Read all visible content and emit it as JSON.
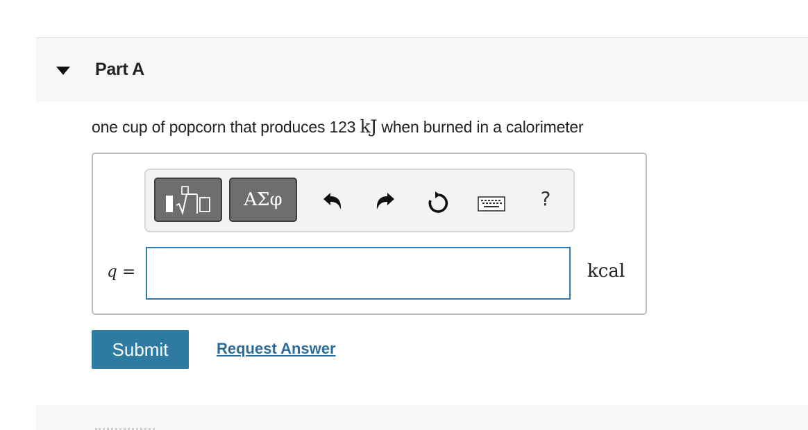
{
  "part": {
    "title": "Part A"
  },
  "question": {
    "text_before": "one cup of popcorn that produces 123 ",
    "unit_math": "kJ",
    "text_after": " when burned in a calorimeter"
  },
  "toolbar": {
    "greek_label": "ΑΣφ",
    "help_label": "?",
    "icons": [
      "template-icon",
      "undo-icon",
      "redo-icon",
      "reset-icon",
      "keyboard-icon"
    ]
  },
  "answer": {
    "variable": "q",
    "equals": " =",
    "value": "",
    "unit": "kcal"
  },
  "actions": {
    "submit_label": "Submit",
    "request_label": "Request Answer"
  },
  "colors": {
    "submit_bg": "#2f7aa0",
    "input_border": "#2b7ab8",
    "link": "#2b6c9a"
  }
}
